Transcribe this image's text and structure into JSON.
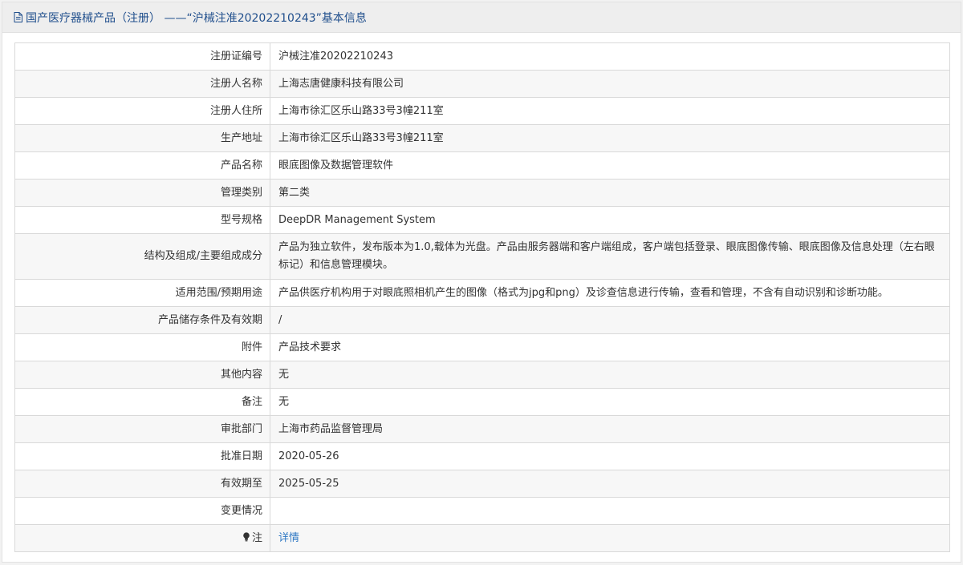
{
  "header": {
    "title": "国产医疗器械产品（注册） ——“沪械注准20202210243”基本信息",
    "icon": "document-icon",
    "color": "#1f4e8c"
  },
  "rows": [
    {
      "label": "注册证编号",
      "value": "沪械注准20202210243"
    },
    {
      "label": "注册人名称",
      "value": "上海志唐健康科技有限公司"
    },
    {
      "label": "注册人住所",
      "value": "上海市徐汇区乐山路33号3幢211室"
    },
    {
      "label": "生产地址",
      "value": "上海市徐汇区乐山路33号3幢211室"
    },
    {
      "label": "产品名称",
      "value": "眼底图像及数据管理软件"
    },
    {
      "label": "管理类别",
      "value": "第二类"
    },
    {
      "label": "型号规格",
      "value": "DeepDR Management System"
    },
    {
      "label": "结构及组成/主要组成成分",
      "value": "产品为独立软件，发布版本为1.0,载体为光盘。产品由服务器端和客户端组成，客户端包括登录、眼底图像传输、眼底图像及信息处理（左右眼标记）和信息管理模块。"
    },
    {
      "label": "适用范围/预期用途",
      "value": "产品供医疗机构用于对眼底照相机产生的图像（格式为jpg和png）及诊查信息进行传输，查看和管理，不含有自动识别和诊断功能。"
    },
    {
      "label": "产品储存条件及有效期",
      "value": "/"
    },
    {
      "label": "附件",
      "value": "产品技术要求"
    },
    {
      "label": "其他内容",
      "value": "无"
    },
    {
      "label": "备注",
      "value": "无"
    },
    {
      "label": "审批部门",
      "value": "上海市药品监督管理局"
    },
    {
      "label": "批准日期",
      "value": "2020-05-26"
    },
    {
      "label": "有效期至",
      "value": "2025-05-25"
    },
    {
      "label": "变更情况",
      "value": ""
    }
  ],
  "note": {
    "label": "注",
    "icon": "lightbulb-icon",
    "link_text": "详情",
    "link_color": "#2f78c4"
  }
}
